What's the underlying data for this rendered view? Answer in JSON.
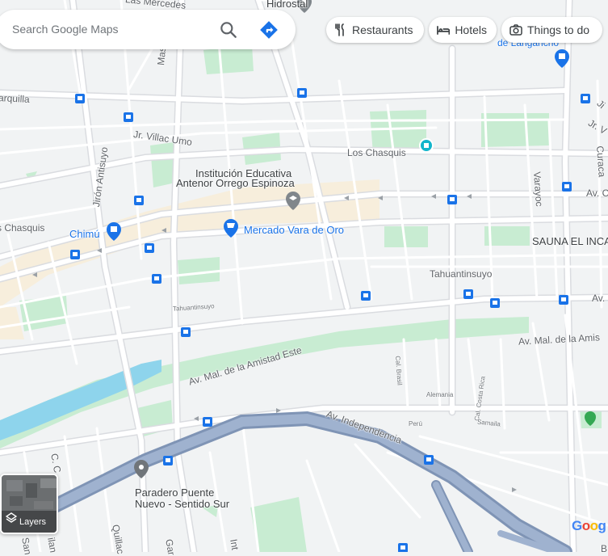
{
  "search": {
    "placeholder": "Search Google Maps"
  },
  "chips": [
    {
      "label": "Restaurants",
      "icon": "fork-knife-icon"
    },
    {
      "label": "Hotels",
      "icon": "bed-icon"
    },
    {
      "label": "Things to do",
      "icon": "camera-icon"
    }
  ],
  "layers": {
    "label": "Layers"
  },
  "logo": "Goog",
  "colors": {
    "road": "#ffffff",
    "road_outline": "#dadce0",
    "highway": "#8ea4c4",
    "park": "#c8ecd2",
    "water": "#8ed4ec",
    "commercial": "#f7eedc",
    "background": "#f1f3f4",
    "poi_blue": "#1a73e8"
  },
  "labels": {
    "las_mercedes": "Las Mercedes",
    "hidrostal": "Hidrostal",
    "de_langancho": "de Langancho",
    "arquilla": "arquilla",
    "mascaypa": "Mascaypa",
    "jr_villac_umo": "Jr. Villac Umo",
    "jiron_antisuyo": "Jirón Antisuyo",
    "los_chasquis_top": "Los Chasquis",
    "varayoc": "Varayoc",
    "curaca": "Curaca",
    "ji": "Ji",
    "jr_v": "Jr. V",
    "institucion": "Institución Educativa",
    "antenor": "Antenor Orrego Espinoza",
    "av_c": "Av. C",
    "s_chasquis": "s Chasquis",
    "chimu": "Chimú",
    "mercado": "Mercado Vara de Oro",
    "sauna": "SAUNA EL INCA",
    "tahuantinsuyo": "Tahuantinsuyo",
    "tahuantinsuyo_small": "Tahuantinsuyo",
    "av_right": "Av.",
    "av_mal_amis": "Av. Mal. de la Amis",
    "av_mal_amistad_este": "Av. Mal. de la Amistad Este",
    "cal_brasil": "Cal. Brasil",
    "alemania": "Alemania",
    "cal_costa_rica": "Cal. Costa Rica",
    "av_independencia": "Av. Independencia",
    "peru": "Perú",
    "samaila": "Samaila",
    "cc": "C. C",
    "paradero_1": "Paradero Puente",
    "paradero_2": "Nuevo - Sentido Sur",
    "quillac": "Quillac",
    "gar": "Gar",
    "int": "Int",
    "san": "San",
    "ilan": "ilan",
    "b": "B"
  }
}
